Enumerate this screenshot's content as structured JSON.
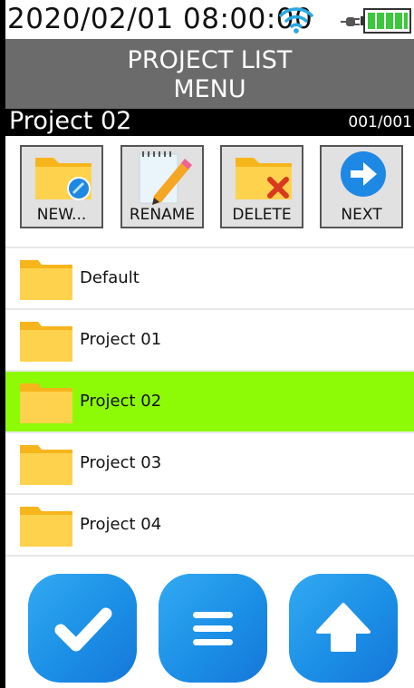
{
  "status": {
    "datetime": "2020/02/01 08:00:00"
  },
  "header": {
    "title_line1": "PROJECT LIST",
    "title_line2": "MENU"
  },
  "namebar": {
    "project": "Project 02",
    "counter": "001/001"
  },
  "toolbar": [
    {
      "label": "NEW...",
      "icon": "new-folder-icon"
    },
    {
      "label": "RENAME",
      "icon": "rename-icon"
    },
    {
      "label": "DELETE",
      "icon": "delete-folder-icon"
    },
    {
      "label": "NEXT",
      "icon": "next-arrow-icon"
    }
  ],
  "projects": [
    {
      "name": "Default",
      "selected": false
    },
    {
      "name": "Project 01",
      "selected": false
    },
    {
      "name": "Project 02",
      "selected": true
    },
    {
      "name": "Project 03",
      "selected": false
    },
    {
      "name": "Project 04",
      "selected": false
    }
  ],
  "bottom_buttons": [
    {
      "icon": "check-icon"
    },
    {
      "icon": "menu-icon"
    },
    {
      "icon": "up-arrow-icon"
    }
  ],
  "colors": {
    "title_bg": "#6b6b6b",
    "selected_row": "#8efb06",
    "button_blue": "#1e96ea",
    "folder_yellow": "#ffc83d"
  }
}
